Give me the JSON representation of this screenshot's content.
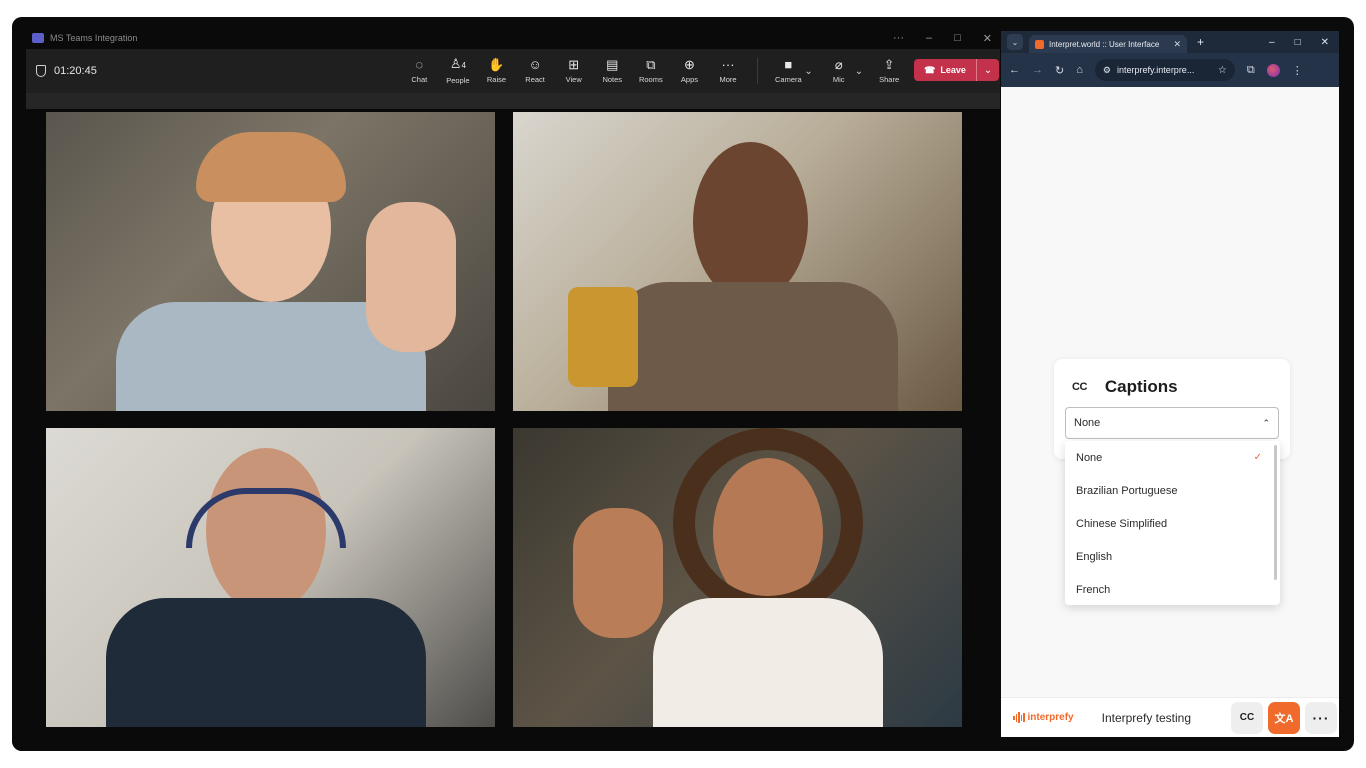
{
  "teams": {
    "app_title": "MS Teams Integration",
    "window_controls": [
      "···",
      "–",
      "□",
      "✕"
    ],
    "timer": "01:20:45",
    "tools": [
      {
        "label": "Chat",
        "icon": "chat-icon",
        "glyph": "◌"
      },
      {
        "label": "People",
        "icon": "people-icon",
        "glyph": "♙",
        "badge": "4"
      },
      {
        "label": "Raise",
        "icon": "raise-hand-icon",
        "glyph": "✋"
      },
      {
        "label": "React",
        "icon": "react-icon",
        "glyph": "☺"
      },
      {
        "label": "View",
        "icon": "view-icon",
        "glyph": "⊞"
      },
      {
        "label": "Notes",
        "icon": "notes-icon",
        "glyph": "▤"
      },
      {
        "label": "Rooms",
        "icon": "rooms-icon",
        "glyph": "⧉"
      },
      {
        "label": "Apps",
        "icon": "apps-icon",
        "glyph": "⊕"
      },
      {
        "label": "More",
        "icon": "more-icon",
        "glyph": "···"
      }
    ],
    "media": [
      {
        "label": "Camera",
        "icon": "camera-icon",
        "glyph": "■"
      },
      {
        "label": "Mic",
        "icon": "mic-muted-icon",
        "glyph": "⌀"
      },
      {
        "label": "Share",
        "icon": "share-icon",
        "glyph": "⇪"
      }
    ],
    "leave_label": "Leave",
    "colors": {
      "leave": "#c4314b",
      "toolbar": "#1f1f1f"
    }
  },
  "browser": {
    "tab_title": "Interpret.world :: User Interface",
    "address": "interprefy.interpre...",
    "controls": [
      "–",
      "□",
      "✕"
    ]
  },
  "captions": {
    "title": "Captions",
    "icon_text": "CC",
    "selected": "None",
    "options": [
      "None",
      "Brazilian Portuguese",
      "Chinese Simplified",
      "English",
      "French"
    ],
    "checked_index": 0
  },
  "footer": {
    "brand": "interprefy",
    "label": "Interprefy testing",
    "cc_button": "CC",
    "translate_button": "文A",
    "more_button": "···",
    "accent": "#f06a2b"
  }
}
